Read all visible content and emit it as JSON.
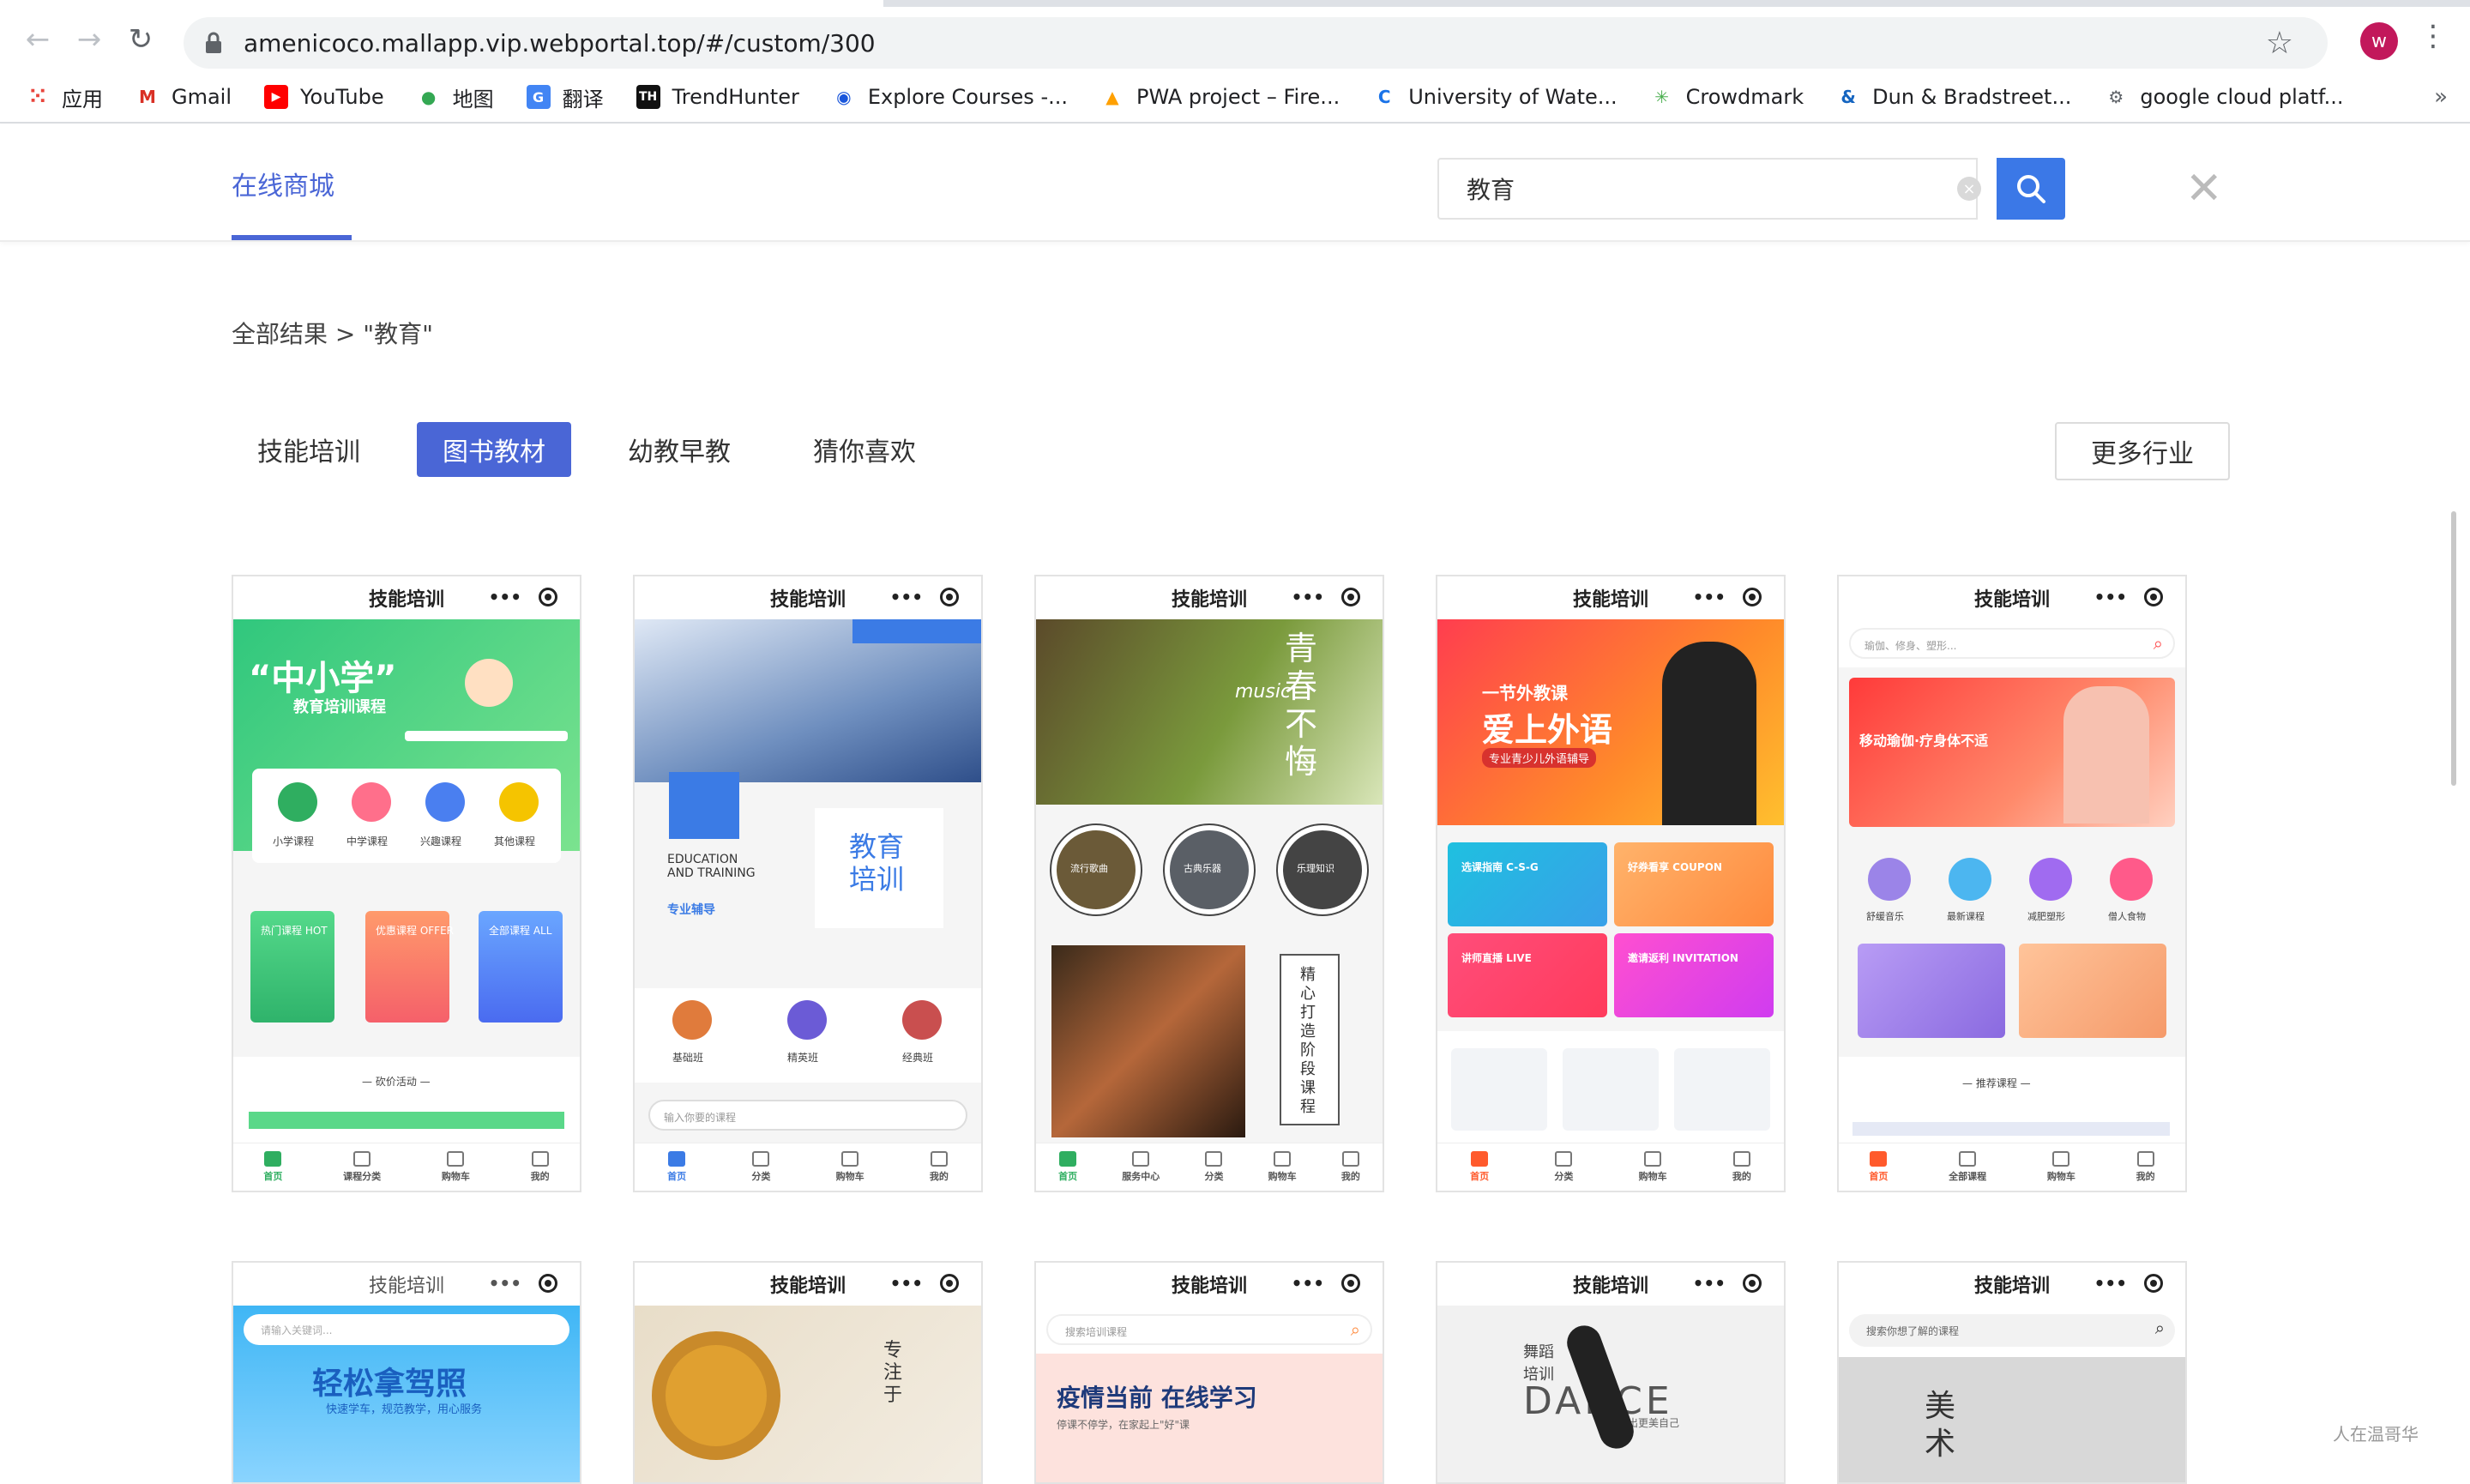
{
  "browser": {
    "url": "amenicoco.mallapp.vip.webportal.top/#/custom/300",
    "profile_initial": "w",
    "bookmarks": [
      {
        "label": "应用",
        "icon": "apps-grid-icon"
      },
      {
        "label": "Gmail",
        "icon": "gmail-icon"
      },
      {
        "label": "YouTube",
        "icon": "youtube-icon"
      },
      {
        "label": "地图",
        "icon": "maps-pin-icon"
      },
      {
        "label": "翻译",
        "icon": "translate-icon"
      },
      {
        "label": "TrendHunter",
        "icon": "trendhunter-icon"
      },
      {
        "label": "Explore Courses -...",
        "icon": "explore-icon"
      },
      {
        "label": "PWA project – Fire...",
        "icon": "firebase-icon"
      },
      {
        "label": "University of Wate...",
        "icon": "uwaterloo-icon"
      },
      {
        "label": "Crowdmark",
        "icon": "crowdmark-icon"
      },
      {
        "label": "Dun & Bradstreet...",
        "icon": "dnb-icon"
      },
      {
        "label": "google cloud platf...",
        "icon": "gcp-icon"
      }
    ],
    "more": "»"
  },
  "header": {
    "brand": "在线商城",
    "search_value": "教育",
    "clear": "×",
    "close": "✕"
  },
  "breadcrumb": "全部结果 > \"教育\"",
  "tabs": [
    {
      "label": "技能培训",
      "active": false
    },
    {
      "label": "图书教材",
      "active": true
    },
    {
      "label": "幼教早教",
      "active": false
    },
    {
      "label": "猜你喜欢",
      "active": false
    }
  ],
  "more_industries": "更多行业",
  "cards": {
    "c1": {
      "title": "技能培训",
      "headline": "“中小学”",
      "sub": "教育培训课程",
      "cats": [
        "小学课程",
        "中学课程",
        "兴趣课程",
        "其他课程"
      ],
      "promos": [
        "热门课程 HOT",
        "优惠课程 OFFER",
        "全部课程 ALL"
      ],
      "bargain": "— 砍价活动 —",
      "nav": [
        "首页",
        "课程分类",
        "购物车",
        "我的"
      ]
    },
    "c2": {
      "title": "技能培训",
      "en": "EDUCATION AND TRAINING",
      "en_sub": "专业辅导",
      "big": "教育培训",
      "levels": [
        "基础班",
        "精英班",
        "经典班"
      ],
      "search": "输入你要的课程",
      "nav": [
        "首页",
        "分类",
        "购物车",
        "我的"
      ]
    },
    "c3": {
      "title": "技能培训",
      "banner": "青春不悔",
      "music": "music",
      "circles": [
        "流行歌曲",
        "古典乐器",
        "乐理知识"
      ],
      "vertical": "精心打造阶段课程",
      "nav": [
        "首页",
        "服务中心",
        "分类",
        "购物车",
        "我的"
      ]
    },
    "c4": {
      "title": "技能培训",
      "banner1": "一节外教课",
      "banner2": "爱上外语",
      "banner3": "专业青少儿外语辅导",
      "tiles": [
        "选课指南 C-S-G",
        "好券看享 COUPON",
        "讲师直播 LIVE",
        "邀请返利 INVITATION"
      ],
      "nav": [
        "首页",
        "分类",
        "购物车",
        "我的"
      ]
    },
    "c5": {
      "title": "技能培训",
      "search": "瑜伽、修身、塑形...",
      "banner": "移动瑜伽·疗身体不适",
      "icons": [
        "舒缓音乐",
        "最新课程",
        "减肥塑形",
        "僧人食物"
      ],
      "recommend": "— 推荐课程 —",
      "nav": [
        "首页",
        "全部课程",
        "购物车",
        "我的"
      ]
    },
    "c6": {
      "title": "技能培训",
      "search": "请输入关键词...",
      "headline": "轻松拿驾照",
      "sub": "快速学车，规范教学，用心服务"
    },
    "c7": {
      "title": "技能培训",
      "vertical": "专注于"
    },
    "c8": {
      "title": "技能培训",
      "search": "搜索培训课程",
      "headline": "疫情当前 在线学习",
      "sub": "停课不停学，在家起上\"好\"课"
    },
    "c9": {
      "title": "技能培训",
      "label": "舞蹈培训",
      "dance": "DANCE",
      "sub": "舞出更美自己"
    },
    "c10": {
      "title": "技能培训",
      "search": "搜索你想了解的课程",
      "art": "美术"
    }
  },
  "watermark": "人在温哥华"
}
